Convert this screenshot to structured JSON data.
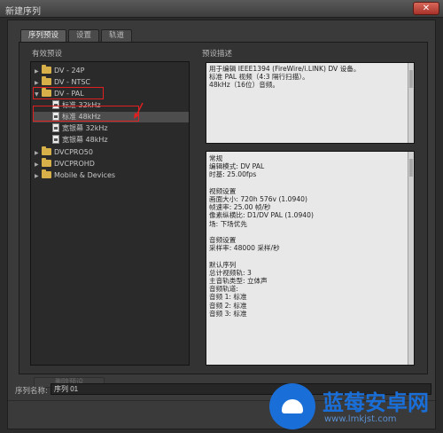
{
  "window": {
    "title": "新建序列",
    "close_label": "✕"
  },
  "tabs": [
    {
      "label": "序列预设",
      "active": true
    },
    {
      "label": "设置",
      "active": false
    },
    {
      "label": "轨道",
      "active": false
    }
  ],
  "presets": {
    "title": "有效预设",
    "items": [
      {
        "type": "folder",
        "label": "DV - 24P",
        "expanded": false
      },
      {
        "type": "folder",
        "label": "DV - NTSC",
        "expanded": false
      },
      {
        "type": "folder",
        "label": "DV - PAL",
        "expanded": true
      },
      {
        "type": "preset",
        "label": "标准 32kHz"
      },
      {
        "type": "preset",
        "label": "标准 48kHz",
        "selected": true
      },
      {
        "type": "preset",
        "label": "宽银幕 32kHz"
      },
      {
        "type": "preset",
        "label": "宽银幕 48kHz"
      },
      {
        "type": "folder",
        "label": "DVCPRO50",
        "expanded": false
      },
      {
        "type": "folder",
        "label": "DVCPROHD",
        "expanded": false
      },
      {
        "type": "folder",
        "label": "Mobile & Devices",
        "expanded": false
      }
    ]
  },
  "description": {
    "title": "预设描述",
    "summary": [
      "用于编辑 IEEE1394 (FireWire/i.LINK) DV 设备。",
      "标准 PAL 视频（4:3 隔行扫描）。",
      "48kHz（16位）音频。"
    ],
    "details": [
      "常规",
      " 编辑模式: DV PAL",
      " 时基: 25.00fps",
      "",
      "视频设置",
      " 画面大小: 720h 576v (1.0940)",
      " 帧速率: 25.00 帧/秒",
      " 像素纵横比: D1/DV PAL (1.0940)",
      " 场: 下场优先",
      "",
      "音频设置",
      " 采样率: 48000 采样/秒",
      "",
      "默认序列",
      " 总计视频轨: 3",
      " 主音轨类型: 立体声",
      " 音频轨道:",
      " 音频 1: 标准",
      " 音频 2: 标准",
      " 音频 3: 标准"
    ]
  },
  "actions": {
    "delete_preset": "删除预设"
  },
  "sequence_name": {
    "label": "序列名称:",
    "value": "序列 01"
  },
  "watermark": {
    "brand": "蓝莓安卓网",
    "url": "www.lmkjst.com"
  },
  "colors": {
    "accent": "#1a6ed8",
    "highlight_box": "#e02020",
    "folder": "#d8b04a"
  }
}
